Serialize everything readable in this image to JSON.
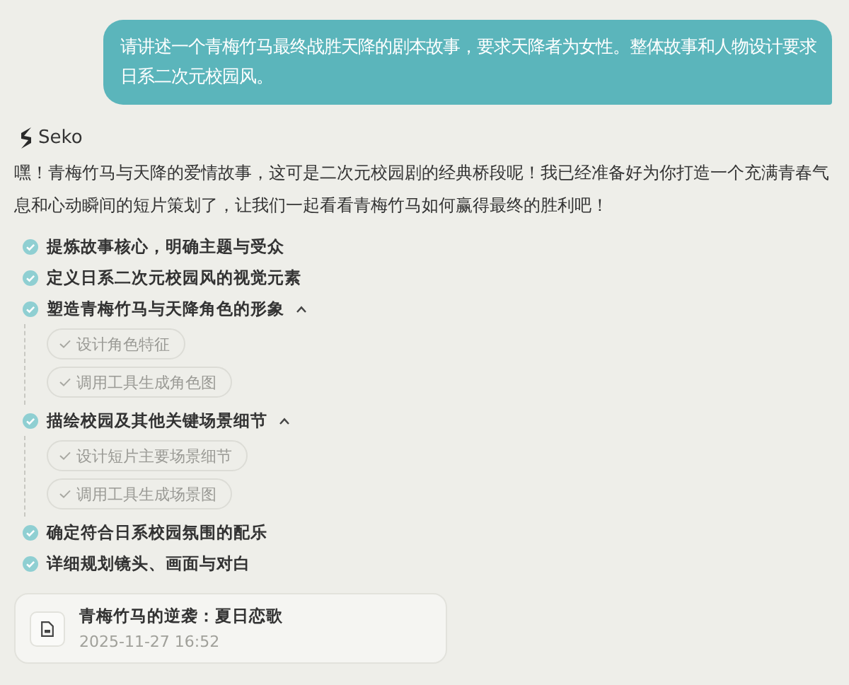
{
  "user_message": "请讲述一个青梅竹马最终战胜天降的剧本故事，要求天降者为女性。整体故事和人物设计要求日系二次元校园风。",
  "assistant": {
    "name": "Seko",
    "intro": "嘿！青梅竹马与天降的爱情故事，这可是二次元校园剧的经典桥段呢！我已经准备好为你打造一个充满青春气息和心动瞬间的短片策划了，让我们一起看看青梅竹马如何赢得最终的胜利吧！"
  },
  "steps": [
    {
      "label": "提炼故事核心，明确主题与受众",
      "done": true
    },
    {
      "label": "定义日系二次元校园风的视觉元素",
      "done": true
    },
    {
      "label": "塑造青梅竹马与天降角色的形象",
      "done": true,
      "expanded": true,
      "children": [
        {
          "label": "设计角色特征",
          "done": true
        },
        {
          "label": "调用工具生成角色图",
          "done": true
        }
      ]
    },
    {
      "label": "描绘校园及其他关键场景细节",
      "done": true,
      "expanded": true,
      "children": [
        {
          "label": "设计短片主要场景细节",
          "done": true
        },
        {
          "label": "调用工具生成场景图",
          "done": true
        }
      ]
    },
    {
      "label": "确定符合日系校园氛围的配乐",
      "done": true
    },
    {
      "label": "详细规划镜头、画面与对白",
      "done": true
    }
  ],
  "document": {
    "title": "青梅竹马的逆袭：夏日恋歌",
    "timestamp": "2025-11-27 16:52"
  }
}
